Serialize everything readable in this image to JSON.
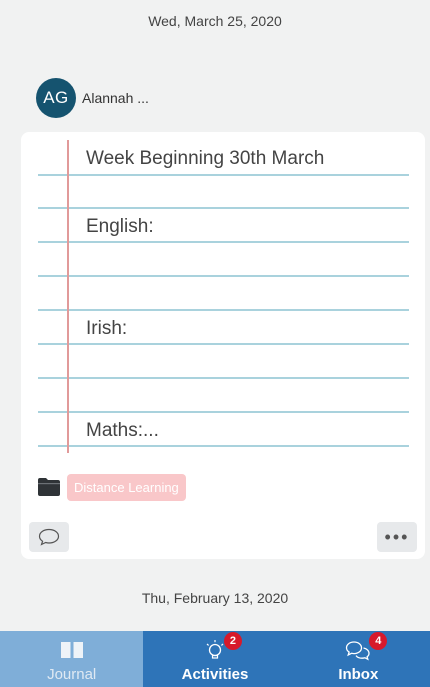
{
  "entries": [
    {
      "date": "Wed, March 25, 2020",
      "author": {
        "initials": "AG",
        "name": "Alannah ..."
      },
      "lines": [
        "Week Beginning 30th March",
        "English:",
        "Irish:",
        "Maths:..."
      ],
      "tag": "Distance Learning"
    }
  ],
  "next_entry_date": "Thu, February 13, 2020",
  "colors": {
    "avatar": "#15536f",
    "tag_bg": "#f9c7c9",
    "tab_active": "#7faed8",
    "tab_inactive": "#2e74b8",
    "badge": "#d7192b",
    "paper_rule": "#a9d2dd",
    "paper_margin": "#e19a9a"
  },
  "tabs": [
    {
      "label": "Journal",
      "icon": "book-icon",
      "active": true
    },
    {
      "label": "Activities",
      "icon": "lightbulb-icon",
      "badge": "2"
    },
    {
      "label": "Inbox",
      "icon": "chat-bubbles-icon",
      "badge": "4"
    }
  ]
}
